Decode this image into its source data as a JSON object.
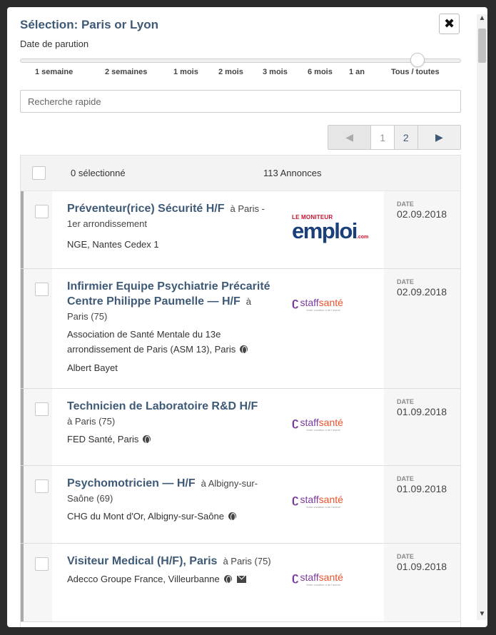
{
  "header": {
    "title": "Sélection: Paris or Lyon",
    "close_label": "✖"
  },
  "filter": {
    "date_label": "Date de parution",
    "ticks": [
      "1 semaine",
      "2 semaines",
      "1 mois",
      "2 mois",
      "3 mois",
      "6 mois",
      "1 an",
      "Tous / toutes"
    ],
    "selected_tick": "Tous / toutes"
  },
  "search": {
    "placeholder": "Recherche rapide",
    "value": ""
  },
  "pagination": {
    "prev": "◀",
    "pages": [
      "1",
      "2"
    ],
    "current": "1",
    "next": "▶"
  },
  "list": {
    "selected_text": "0 sélectionné",
    "count_text": "113 Annonces",
    "date_heading": "DATE",
    "rows": [
      {
        "title": "Préventeur(rice) Sécurité H/F",
        "location": "à Paris - 1er arrondissement",
        "company": "NGE, Nantes Cedex 1",
        "contact": "",
        "logo": "lemoniteur-emploi",
        "logo_text_top": "LE MONITEUR",
        "logo_text_bottom": "emploi",
        "logo_text_side": ".com",
        "date": "02.09.2018"
      },
      {
        "title": "Infirmier Equipe Psychiatrie Précarité Centre Philippe Paumelle — H/F",
        "location": "à Paris (75)",
        "company": "Association de Santé Mentale du 13e arrondissement de Paris (ASM 13), Paris",
        "contact": "Albert Bayet",
        "logo": "staffsante",
        "date": "02.09.2018"
      },
      {
        "title": "Technicien de Laboratoire R&D H/F",
        "location": "à Paris (75)",
        "company": "FED Santé, Paris",
        "contact": "",
        "logo": "staffsante",
        "date": "01.09.2018"
      },
      {
        "title": "Psychomotricien — H/F",
        "location": "à Albigny-sur-Saône (69)",
        "company": "CHG du Mont d'Or, Albigny-sur-Saône",
        "contact": "",
        "logo": "staffsante",
        "date": "01.09.2018"
      },
      {
        "title": "Visiteur Medical (H/F), Paris",
        "location": "à Paris (75)",
        "company": "Adecco Groupe France, Villeurbanne",
        "contact": "",
        "logo": "staffsante",
        "date": "01.09.2018"
      }
    ]
  },
  "staffsante_logo": {
    "mark": "ʗ",
    "word_a": "staff",
    "word_b": "santé",
    "tagline": "Votre vocation a de l'avenir"
  },
  "scrollbar": {
    "up": "▲",
    "down": "▼"
  }
}
